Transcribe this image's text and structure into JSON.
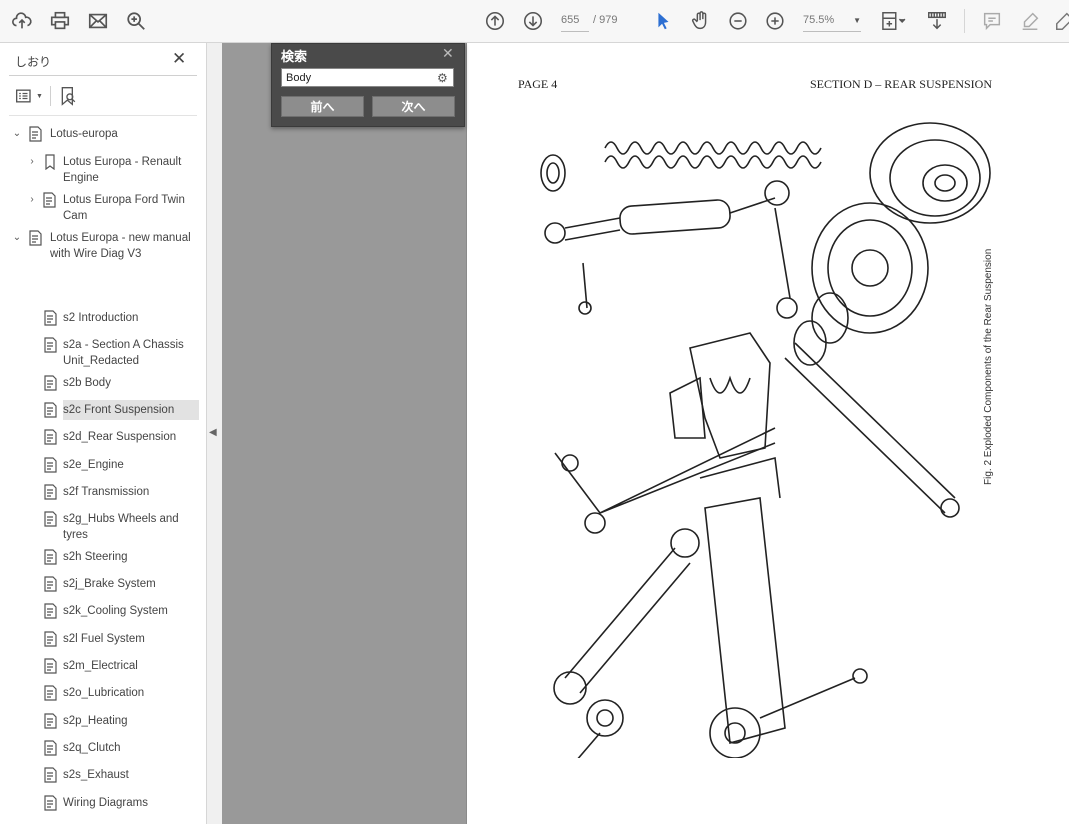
{
  "toolbar": {
    "page_current": "655",
    "page_total": "/ 979",
    "zoom": "75.5%"
  },
  "sidebar": {
    "title": "しおり",
    "close": "✕",
    "items": [
      {
        "label": "Lotus-europa"
      },
      {
        "label": "Lotus Europa - Renault Engine"
      },
      {
        "label": "Lotus Europa Ford Twin Cam"
      },
      {
        "label": "Lotus Europa - new manual with Wire Diag V3"
      },
      {
        "label": "s2 Introduction"
      },
      {
        "label": "s2a - Section A Chassis Unit_Redacted"
      },
      {
        "label": "s2b Body"
      },
      {
        "label": "s2c Front Suspension"
      },
      {
        "label": "s2d_Rear Suspension"
      },
      {
        "label": "s2e_Engine"
      },
      {
        "label": "s2f Transmission"
      },
      {
        "label": "s2g_Hubs Wheels and tyres"
      },
      {
        "label": "s2h Steering"
      },
      {
        "label": "s2j_Brake System"
      },
      {
        "label": "s2k_Cooling System"
      },
      {
        "label": "s2l Fuel System"
      },
      {
        "label": "s2m_Electrical"
      },
      {
        "label": "s2o_Lubrication"
      },
      {
        "label": "s2p_Heating"
      },
      {
        "label": "s2q_Clutch"
      },
      {
        "label": "s2s_Exhaust"
      },
      {
        "label": "Wiring Diagrams"
      }
    ]
  },
  "find": {
    "title": "検索",
    "query": "Body",
    "prev": "前へ",
    "next": "次へ"
  },
  "page": {
    "header_left": "PAGE 4",
    "header_right": "SECTION D – REAR SUSPENSION",
    "caption": "Fig. 2   Exploded Components of the Rear Suspension"
  }
}
